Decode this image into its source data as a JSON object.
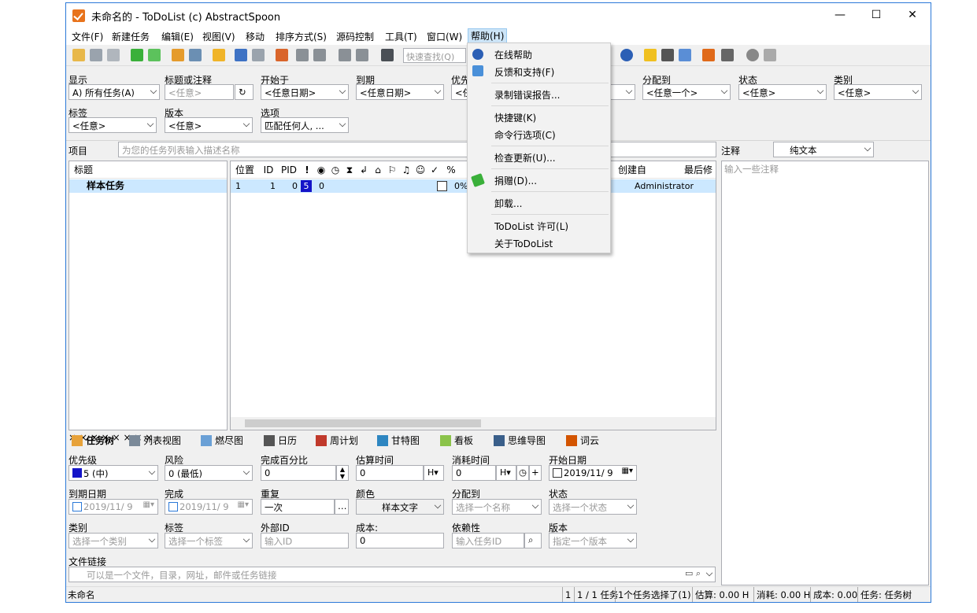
{
  "window": {
    "title": "未命名的 - ToDoList (c) AbstractSpoon",
    "minimize": "—",
    "maximize": "☐",
    "close": "✕"
  },
  "menubar": [
    "文件(F)",
    "新建任务",
    "编辑(E)",
    "视图(V)",
    "移动",
    "排序方式(S)",
    "源码控制",
    "工具(T)",
    "窗口(W)",
    "帮助(H)"
  ],
  "toolbar": {
    "quick_find_placeholder": "快速查找(Q)"
  },
  "filters": {
    "show": {
      "label": "显示",
      "value": "A)  所有任务(A)"
    },
    "title_comment": {
      "label": "标题或注释",
      "value": "<任意>"
    },
    "start": {
      "label": "开始于",
      "value": "<任意日期>"
    },
    "due": {
      "label": "到期",
      "value": "<任意日期>"
    },
    "priority": {
      "label": "优先",
      "value": "<任"
    },
    "assigned": {
      "label": "分配到",
      "value": "<任意一个>"
    },
    "status": {
      "label": "状态",
      "value": "<任意>"
    },
    "category": {
      "label": "类别",
      "value": "<任意>"
    },
    "tags": {
      "label": "标签",
      "value": "<任意>"
    },
    "version": {
      "label": "版本",
      "value": "<任意>"
    },
    "options": {
      "label": "选项",
      "value": "匹配任何人, ..."
    }
  },
  "project": {
    "label": "项目",
    "placeholder": "为您的任务列表输入描述名称"
  },
  "comments": {
    "label": "注释",
    "format": "纯文本",
    "placeholder": "输入一些注释"
  },
  "tree": {
    "header": "标题",
    "task": "样本任务"
  },
  "columns": [
    "位置",
    "ID",
    "PID",
    "!",
    "",
    "",
    "",
    "",
    "",
    "",
    "",
    "",
    "",
    "%",
    "创建自",
    "最后修"
  ],
  "row": {
    "pos": "1",
    "id": "1",
    "pid": "0",
    "priority": "5",
    "risk": "0",
    "percent": "0%",
    "creator": "Administrator"
  },
  "tabs": [
    "任务树",
    "列表视图",
    "燃尽图",
    "日历",
    "周计划",
    "甘特图",
    "看板",
    "思维导图",
    "词云"
  ],
  "fields": {
    "priority": {
      "label": "优先级",
      "value": "5 (中)"
    },
    "risk": {
      "label": "风险",
      "value": "0 (最低)"
    },
    "percent": {
      "label": "完成百分比",
      "value": "0"
    },
    "estimate": {
      "label": "估算时间",
      "value": "0",
      "unit": "H"
    },
    "spent": {
      "label": "消耗时间",
      "value": "0",
      "unit": "H"
    },
    "start_date": {
      "label": "开始日期",
      "value": "2019/11/ 9"
    },
    "due_date": {
      "label": "到期日期",
      "value": "2019/11/ 9"
    },
    "done": {
      "label": "完成",
      "value": "2019/11/ 9"
    },
    "recurrence": {
      "label": "重复",
      "value": "一次"
    },
    "color": {
      "label": "颜色",
      "value": "样本文字"
    },
    "assigned": {
      "label": "分配到",
      "placeholder": "选择一个名称"
    },
    "status": {
      "label": "状态",
      "placeholder": "选择一个状态"
    },
    "category": {
      "label": "类别",
      "placeholder": "选择一个类别"
    },
    "tags": {
      "label": "标签",
      "placeholder": "选择一个标签"
    },
    "external_id": {
      "label": "外部ID",
      "placeholder": "输入ID"
    },
    "cost": {
      "label": "成本:",
      "value": "0"
    },
    "depends": {
      "label": "依赖性",
      "placeholder": "输入任务ID"
    },
    "version": {
      "label": "版本",
      "placeholder": "指定一个版本"
    },
    "file_link": {
      "label": "文件链接",
      "placeholder": "可以是一个文件，目录，网址，邮件或任务链接"
    }
  },
  "status": {
    "left": "未命名",
    "s1": "1",
    "s2": "1 / 1 任务",
    "s3": "1个任务选择了(1)",
    "s4": "估算: 0.00 H",
    "s5": "消耗: 0.00 H",
    "s6": "成本: 0.00",
    "s7": "任务: 任务树"
  },
  "help_menu": {
    "online_help": "在线帮助",
    "feedback": "反馈和支持(F)",
    "record_bug": "录制错误报告...",
    "shortcuts": "快捷键(K)",
    "cmdline": "命令行选项(C)",
    "check_update": "检查更新(U)...",
    "donate": "捐赠(D)...",
    "uninstall": "卸载...",
    "license": "ToDoList 许可(L)",
    "about": "关于ToDoList"
  },
  "colors": {
    "accent": "#2b79d8",
    "selection": "#cce8ff",
    "priority5": "#1414c8"
  }
}
